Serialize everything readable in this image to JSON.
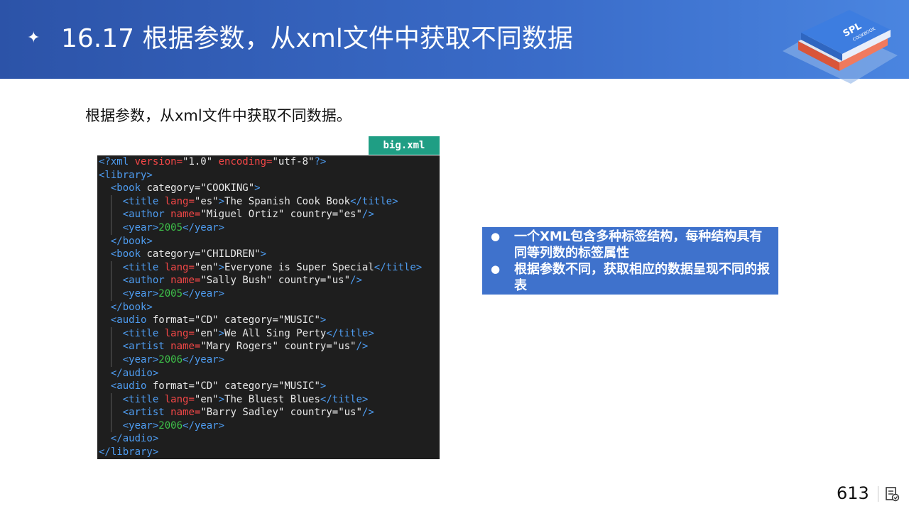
{
  "header": {
    "bullet_glyph": "✦",
    "title": "16.17 根据参数，从xml文件中获取不同数据",
    "logo_text": "SPL",
    "logo_subtext": "COOKBOOK"
  },
  "subtitle": "根据参数，从xml文件中获取不同数据。",
  "file_tag": "big.xml",
  "code": {
    "lines": [
      [
        [
          "t",
          "<?xml "
        ],
        [
          "a",
          "version="
        ],
        [
          "s",
          "\"1.0\" "
        ],
        [
          "a",
          "encoding="
        ],
        [
          "s",
          "\"utf-8\""
        ],
        [
          "t",
          "?>"
        ]
      ],
      [
        [
          "t",
          "<library>"
        ]
      ],
      [
        [
          "x",
          "  "
        ],
        [
          "t",
          "<book "
        ],
        [
          "s",
          "category="
        ],
        [
          "s",
          "\"COOKING\""
        ],
        [
          "t",
          ">"
        ]
      ],
      [
        [
          "x",
          "    "
        ],
        [
          "t",
          "<title "
        ],
        [
          "a",
          "lang="
        ],
        [
          "s",
          "\"es\""
        ],
        [
          "t",
          ">"
        ],
        [
          "x",
          "The Spanish Cook Book"
        ],
        [
          "t",
          "</title>"
        ]
      ],
      [
        [
          "x",
          "    "
        ],
        [
          "t",
          "<author "
        ],
        [
          "a",
          "name="
        ],
        [
          "s",
          "\"Miguel Ortiz\" "
        ],
        [
          "x",
          "country="
        ],
        [
          "s",
          "\"es\""
        ],
        [
          "t",
          "/>"
        ]
      ],
      [
        [
          "x",
          "    "
        ],
        [
          "t",
          "<year>"
        ],
        [
          "n",
          "2005"
        ],
        [
          "t",
          "</year>"
        ]
      ],
      [
        [
          "x",
          "  "
        ],
        [
          "t",
          "</book>"
        ]
      ],
      [
        [
          "x",
          "  "
        ],
        [
          "t",
          "<book "
        ],
        [
          "s",
          "category="
        ],
        [
          "s",
          "\"CHILDREN\""
        ],
        [
          "t",
          ">"
        ]
      ],
      [
        [
          "x",
          "    "
        ],
        [
          "t",
          "<title "
        ],
        [
          "a",
          "lang="
        ],
        [
          "s",
          "\"en\""
        ],
        [
          "t",
          ">"
        ],
        [
          "x",
          "Everyone is Super Special"
        ],
        [
          "t",
          "</title>"
        ]
      ],
      [
        [
          "x",
          "    "
        ],
        [
          "t",
          "<author "
        ],
        [
          "a",
          "name="
        ],
        [
          "s",
          "\"Sally Bush\" "
        ],
        [
          "x",
          "country="
        ],
        [
          "s",
          "\"us\""
        ],
        [
          "t",
          "/>"
        ]
      ],
      [
        [
          "x",
          "    "
        ],
        [
          "t",
          "<year>"
        ],
        [
          "n",
          "2005"
        ],
        [
          "t",
          "</year>"
        ]
      ],
      [
        [
          "x",
          "  "
        ],
        [
          "t",
          "</book>"
        ]
      ],
      [
        [
          "x",
          "  "
        ],
        [
          "t",
          "<audio "
        ],
        [
          "x",
          "format="
        ],
        [
          "s",
          "\"CD\" "
        ],
        [
          "x",
          "category="
        ],
        [
          "s",
          "\"MUSIC\""
        ],
        [
          "t",
          ">"
        ]
      ],
      [
        [
          "x",
          "    "
        ],
        [
          "t",
          "<title "
        ],
        [
          "a",
          "lang="
        ],
        [
          "s",
          "\"en\""
        ],
        [
          "t",
          ">"
        ],
        [
          "x",
          "We All Sing Perty"
        ],
        [
          "t",
          "</title>"
        ]
      ],
      [
        [
          "x",
          "    "
        ],
        [
          "t",
          "<artist "
        ],
        [
          "a",
          "name="
        ],
        [
          "s",
          "\"Mary Rogers\" "
        ],
        [
          "x",
          "country="
        ],
        [
          "s",
          "\"us\""
        ],
        [
          "t",
          "/>"
        ]
      ],
      [
        [
          "x",
          "    "
        ],
        [
          "t",
          "<year>"
        ],
        [
          "n",
          "2006"
        ],
        [
          "t",
          "</year>"
        ]
      ],
      [
        [
          "x",
          "  "
        ],
        [
          "t",
          "</audio>"
        ]
      ],
      [
        [
          "x",
          "  "
        ],
        [
          "t",
          "<audio "
        ],
        [
          "x",
          "format="
        ],
        [
          "s",
          "\"CD\" "
        ],
        [
          "x",
          "category="
        ],
        [
          "s",
          "\"MUSIC\""
        ],
        [
          "t",
          ">"
        ]
      ],
      [
        [
          "x",
          "    "
        ],
        [
          "t",
          "<title "
        ],
        [
          "a",
          "lang="
        ],
        [
          "s",
          "\"en\""
        ],
        [
          "t",
          ">"
        ],
        [
          "x",
          "The Bluest Blues"
        ],
        [
          "t",
          "</title>"
        ]
      ],
      [
        [
          "x",
          "    "
        ],
        [
          "t",
          "<artist "
        ],
        [
          "a",
          "name="
        ],
        [
          "s",
          "\"Barry Sadley\" "
        ],
        [
          "x",
          "country="
        ],
        [
          "s",
          "\"us\""
        ],
        [
          "t",
          "/>"
        ]
      ],
      [
        [
          "x",
          "    "
        ],
        [
          "t",
          "<year>"
        ],
        [
          "n",
          "2006"
        ],
        [
          "t",
          "</year>"
        ]
      ],
      [
        [
          "x",
          "  "
        ],
        [
          "t",
          "</audio>"
        ]
      ],
      [
        [
          "t",
          "</library>"
        ]
      ]
    ]
  },
  "bullets": [
    "一个XML包含多种标签结构，每种结构具有同等列数的标签属性",
    "根据参数不同，获取相应的数据呈现不同的报表"
  ],
  "bullet_glyph": "●",
  "page_number": "613",
  "colors": {
    "header_start": "#2c53a8",
    "header_end": "#4a85e0",
    "file_tag": "#1f9e84",
    "code_bg": "#1e1e1e",
    "xml_tag": "#4e9cf0",
    "xml_attr": "#f44747",
    "xml_number": "#3ec34a",
    "callout_bg": "#3f72cc"
  }
}
